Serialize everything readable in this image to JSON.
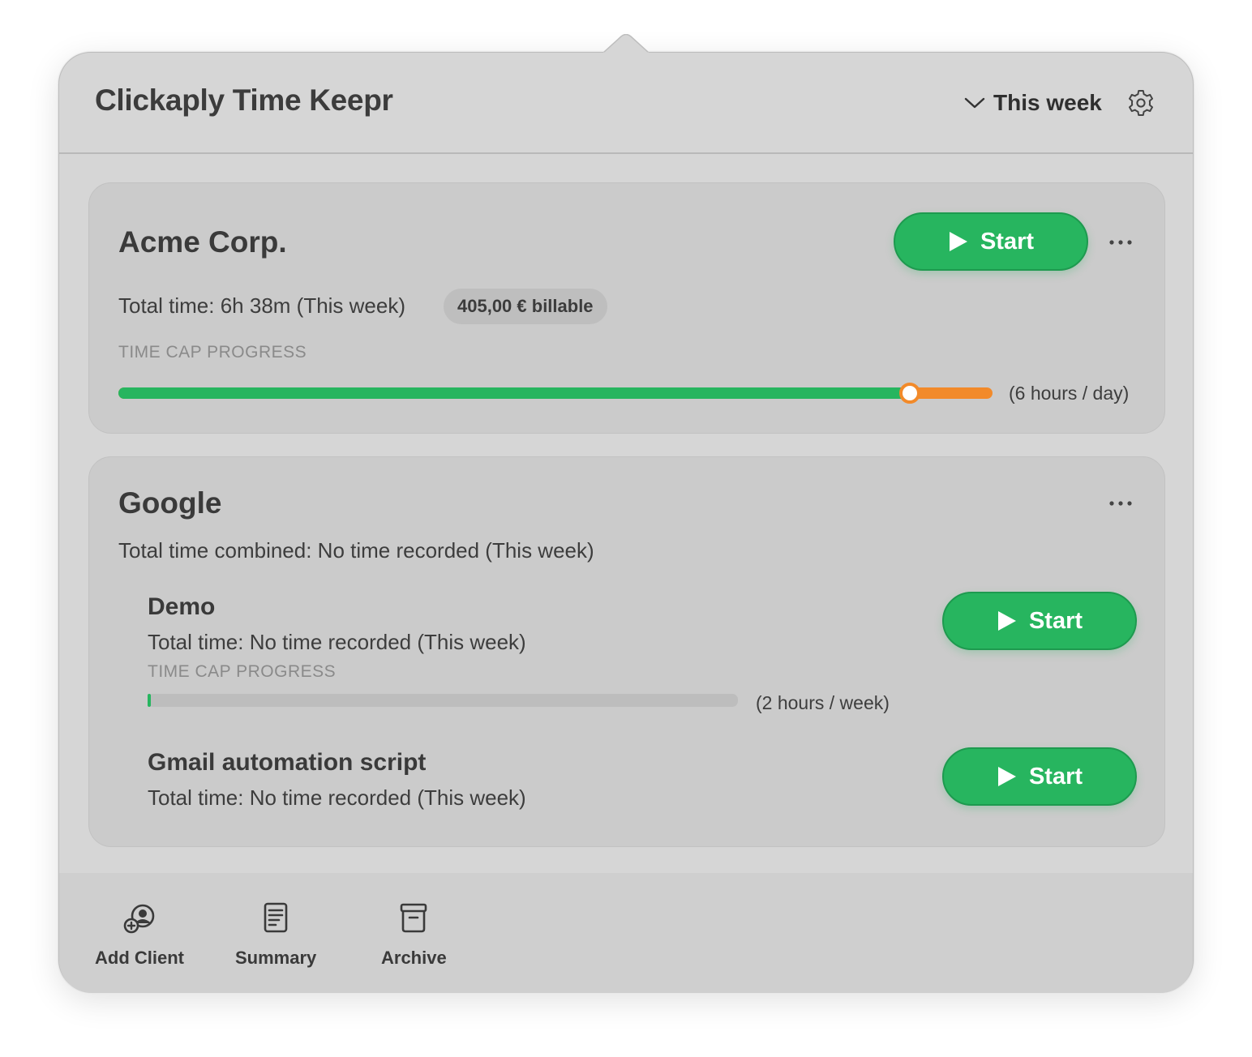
{
  "app": {
    "title": "Clickaply Time Keepr",
    "period": "This week",
    "icons": {
      "period": "chevron-down-icon",
      "settings": "gear-icon"
    }
  },
  "colors": {
    "accent_green": "#27b55f",
    "warning_orange": "#f28a2a",
    "track_gray": "#bdbdbd",
    "panel_bg": "#d6d6d6"
  },
  "clients": [
    {
      "name": "Acme Corp.",
      "start_label": "Start",
      "total_time": "Total time: 6h 38m (This week)",
      "billable": "405,00 € billable",
      "cap_label": "TIME CAP PROGRESS",
      "cap_note": "(6 hours / day)",
      "cap_progress": 0.905,
      "cap_over": true
    },
    {
      "name": "Google",
      "total_time": "Total time combined: No time recorded (This week)",
      "projects": [
        {
          "name": "Demo",
          "total_time": "Total time: No time recorded (This week)",
          "cap_label": "TIME CAP PROGRESS",
          "cap_note": "(2 hours / week)",
          "cap_progress": 0.005,
          "start_label": "Start"
        },
        {
          "name": "Gmail automation script",
          "total_time": "Total time: No time recorded (This week)",
          "start_label": "Start"
        }
      ]
    }
  ],
  "footer": [
    {
      "label": "Add Client",
      "icon": "add-client-icon"
    },
    {
      "label": "Summary",
      "icon": "summary-icon"
    },
    {
      "label": "Archive",
      "icon": "archive-icon"
    }
  ]
}
